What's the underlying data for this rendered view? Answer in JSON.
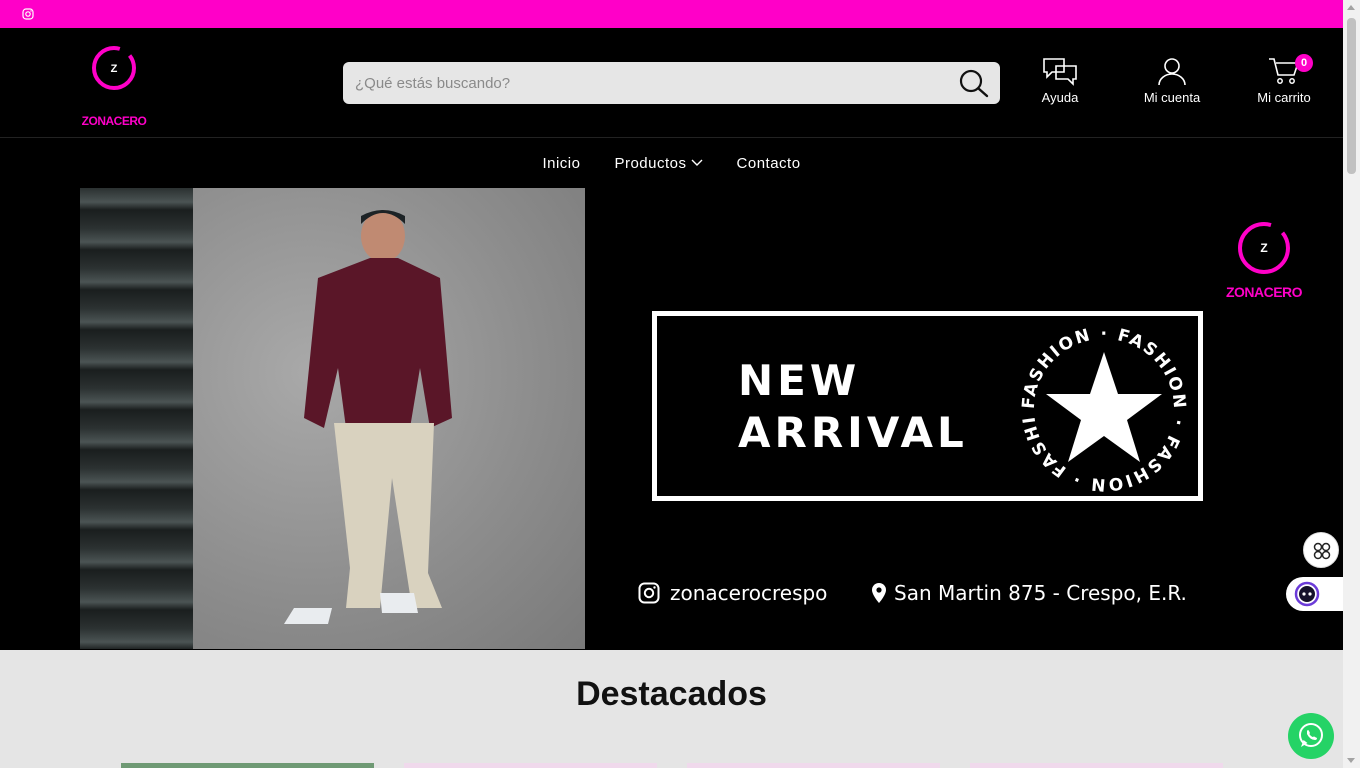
{
  "topbar": {
    "instagram_icon": "instagram-icon"
  },
  "header": {
    "logo_text": "ZONACERO",
    "logo_mark": "Z",
    "search_placeholder": "¿Qué estás buscando?",
    "help_label": "Ayuda",
    "account_label": "Mi cuenta",
    "cart_label": "Mi carrito",
    "cart_count": "0"
  },
  "nav": {
    "items": [
      {
        "label": "Inicio"
      },
      {
        "label": "Productos"
      },
      {
        "label": "Contacto"
      }
    ]
  },
  "banner": {
    "logo_text": "ZONACERO",
    "logo_mark": "Z",
    "headline_1": "NEW",
    "headline_2": "ARRIVAL",
    "stamp_text": "FASHION · FASHION · FASHION · FASHION ·",
    "instagram_handle": "zonacerocrespo",
    "address": "San Martin 875 - Crespo, E.R."
  },
  "featured": {
    "title": "Destacados"
  },
  "colors": {
    "accent": "#ff00c8",
    "background": "#000000",
    "whatsapp": "#25d366"
  }
}
